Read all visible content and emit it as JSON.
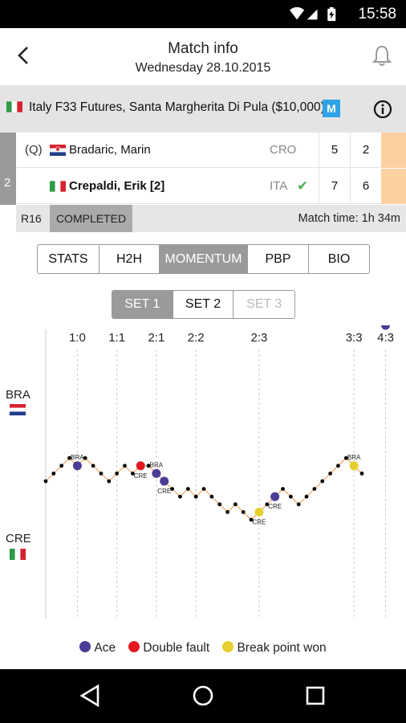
{
  "status_bar": {
    "time": "15:58",
    "icons": [
      "wifi-icon",
      "signal-icon",
      "battery-charging-icon"
    ]
  },
  "header": {
    "title": "Match info",
    "subtitle": "Wednesday 28.10.2015"
  },
  "tournament": {
    "name": "Italy F33 Futures, Santa Margherita Di Pula ($10,000)",
    "badge": "M"
  },
  "match": {
    "round_number": "2",
    "round": "R16",
    "status": "COMPLETED",
    "match_time": "Match time: 1h 34m",
    "players": [
      {
        "seed": "(Q)",
        "name": "Bradaric, Marin",
        "country": "CRO",
        "set1": "5",
        "set2": "2",
        "winner": false
      },
      {
        "seed": "",
        "name": "Crepaldi, Erik [2]",
        "country": "ITA",
        "set1": "7",
        "set2": "6",
        "winner": true
      }
    ]
  },
  "tabs": [
    "STATS",
    "H2H",
    "MOMENTUM",
    "PBP",
    "BIO"
  ],
  "active_tab": "MOMENTUM",
  "set_tabs": [
    "SET 1",
    "SET 2",
    "SET 3"
  ],
  "active_set": "SET 1",
  "colors": {
    "ace": "#4b3c96",
    "double_fault": "#e11a22",
    "break_point": "#e6cf2e",
    "line": "#f4a460",
    "score_col": "#fdd0a2"
  },
  "chart_data": {
    "type": "line",
    "title": "",
    "top_label": "BRA",
    "bottom_label": "CRE",
    "game_markers": [
      "1:0",
      "1:1",
      "2:1",
      "2:2",
      "2:3",
      "3:3",
      "4:3"
    ],
    "game_end_points": [
      4,
      9,
      14,
      19,
      27,
      39,
      43
    ],
    "ylim": [
      -5,
      5
    ],
    "momentum": [
      0,
      1,
      2,
      3,
      2,
      3,
      2,
      1,
      0,
      1,
      2,
      1,
      2,
      2,
      1,
      0,
      -1,
      -2,
      -1,
      -2,
      -1,
      -2,
      -3,
      -4,
      -3,
      -4,
      -5,
      -4,
      -3,
      -2,
      -1,
      -2,
      -3,
      -2,
      -1,
      0,
      1,
      2,
      3,
      2,
      1
    ],
    "events": [
      {
        "point": 4,
        "type": "ace",
        "player": "BRA"
      },
      {
        "point": 12,
        "type": "double_fault",
        "player": "CRE"
      },
      {
        "point": 14,
        "type": "ace",
        "player": "BRA"
      },
      {
        "point": 15,
        "type": "ace",
        "player": "CRE"
      },
      {
        "point": 27,
        "type": "break_point",
        "player": "CRE"
      },
      {
        "point": 29,
        "type": "ace",
        "player": "CRE"
      },
      {
        "point": 39,
        "type": "break_point",
        "player": "BRA"
      },
      {
        "point": 43,
        "type": "ace",
        "player": "BRA"
      }
    ]
  },
  "legend": [
    {
      "label": "Ace",
      "color": "#4b3c96"
    },
    {
      "label": "Double fault",
      "color": "#e11a22"
    },
    {
      "label": "Break point won",
      "color": "#e6cf2e"
    }
  ],
  "nav": [
    "back-nav-icon",
    "home-nav-icon",
    "recents-nav-icon"
  ]
}
